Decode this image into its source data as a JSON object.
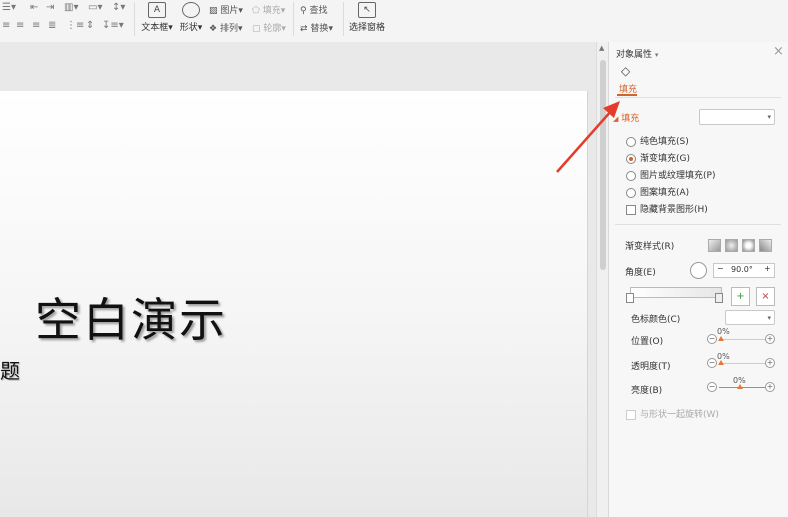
{
  "ribbon": {
    "text_box": "文本框",
    "shape": "形状",
    "picture": "图片",
    "fill": "填充",
    "arrange": "排列",
    "outline": "轮廓",
    "find": "查找",
    "replace": "替换",
    "selection_pane": "选择窗格",
    "caret": "▾"
  },
  "slide": {
    "title": "空白演示",
    "subtitle": "题"
  },
  "panel": {
    "title": "对象属性",
    "title_caret": "▾",
    "close": "×",
    "tab_fill": "填充",
    "section_fill": "填充",
    "options": [
      {
        "label": "纯色填充(S)",
        "selected": false
      },
      {
        "label": "渐变填充(G)",
        "selected": true
      },
      {
        "label": "图片或纹理填充(P)",
        "selected": false
      },
      {
        "label": "图案填充(A)",
        "selected": false
      }
    ],
    "hide_background": "隐藏背景图形(H)",
    "gradient_style": "渐变样式(R)",
    "angle_label": "角度(E)",
    "angle_value": "90.0°",
    "minus": "−",
    "plus": "+",
    "stop_color": "色标颜色(C)",
    "position_label": "位置(O)",
    "position_value": "0%",
    "transparency_label": "透明度(T)",
    "transparency_value": "0%",
    "brightness_label": "亮度(B)",
    "brightness_value": "0%",
    "rotate_with_shape": "与形状一起旋转(W)"
  },
  "colors": {
    "accent": "#d4642a",
    "arrow": "#e53b2b"
  }
}
